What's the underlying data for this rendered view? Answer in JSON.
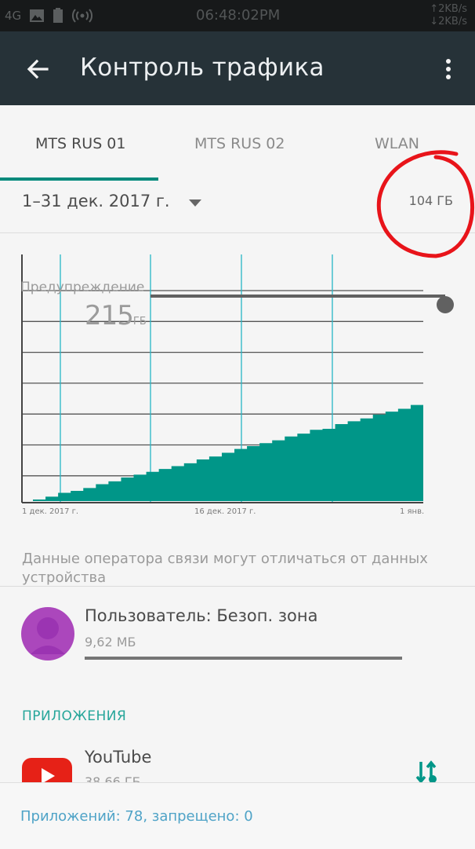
{
  "status_bar": {
    "network": "4G",
    "time": "06:48:02PM",
    "upload": "↑2KB/s",
    "download": "↓2KB/s",
    "icons": [
      "image-icon",
      "battery-icon",
      "hotspot-icon"
    ]
  },
  "app_bar": {
    "title": "Контроль трафика",
    "back_icon": "arrow-back-icon",
    "menu_icon": "more-vert-icon",
    "color": "#263238"
  },
  "tabs": [
    {
      "label": "MTS RUS 01",
      "active": true
    },
    {
      "label": "MTS RUS 02",
      "active": false
    },
    {
      "label": "WLAN",
      "active": false
    }
  ],
  "period": {
    "range": "1–31 дек. 2017 г.",
    "total": "104 ГБ"
  },
  "chart_data": {
    "type": "area",
    "warning_label": "Предупреждение",
    "warning_value": "215",
    "warning_unit": "ГБ",
    "x_tick_labels": [
      "1 дек. 2017 г.",
      "16 дек. 2017 г.",
      "1 янв."
    ],
    "days": [
      1,
      2,
      3,
      4,
      5,
      6,
      7,
      8,
      9,
      10,
      11,
      12,
      13,
      14,
      15,
      16,
      17,
      18,
      19,
      20,
      21,
      22,
      23,
      24,
      25,
      26,
      27,
      28,
      29,
      30,
      31,
      32
    ],
    "cumulative_gb": [
      0,
      3,
      7,
      9,
      12,
      16,
      19,
      23,
      26,
      29,
      32,
      35,
      38,
      42,
      45,
      49,
      53,
      56,
      59,
      62,
      66,
      69,
      73,
      74,
      79,
      82,
      85,
      89,
      92,
      95,
      99,
      104
    ],
    "ylim": [
      0,
      260
    ],
    "fill_color": "#009688",
    "grid": true
  },
  "note": "Данные оператора связи могут отличаться от данных устройства",
  "user": {
    "name": "Пользователь: Безоп. зона",
    "size": "9,62 МБ",
    "avatar_color": "#ab47bc"
  },
  "apps_section": {
    "header": "ПРИЛОЖЕНИЯ",
    "items": [
      {
        "name": "YouTube",
        "size": "38,66 ГБ",
        "icon": "youtube-icon"
      }
    ]
  },
  "footer": {
    "text": "Приложений: 78, запрещено: 0"
  }
}
